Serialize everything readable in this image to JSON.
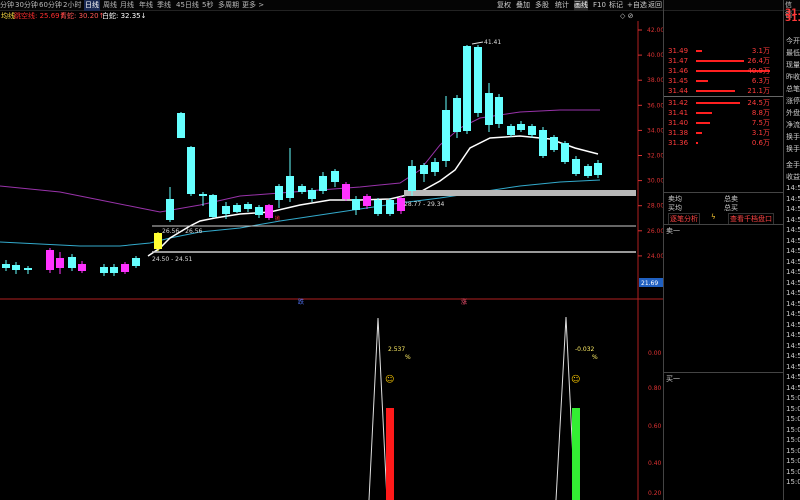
{
  "toolbar": {
    "periods": [
      "分钟",
      "30分钟",
      "60分钟",
      "2小时",
      "日线",
      "周线",
      "月线",
      "年线",
      "季线",
      "45日线",
      "5秒",
      "多周期",
      "更多 >"
    ],
    "active_period": "日线",
    "right_buttons": [
      "复权",
      "叠加",
      "多股",
      "统计",
      "画线",
      "F10",
      "标记",
      "+自选",
      "返回"
    ],
    "panel_title": "信德",
    "small_icons": "◇ ⊘"
  },
  "ma_legend": {
    "name": "均线",
    "items": [
      {
        "label": "跳空线: 25.69↑",
        "color": "#ff2e2e"
      },
      {
        "label": "青蛇: 30.20↑",
        "color": "#ff5555"
      },
      {
        "label": "白蛇: 32.35↓",
        "color": "#ffffff"
      }
    ]
  },
  "price_axis": {
    "labels": [
      "42.00",
      "40.00",
      "38.00",
      "36.00",
      "34.00",
      "32.00",
      "30.00",
      "28.00",
      "26.00",
      "24.00"
    ],
    "current_price": "21.69",
    "current_price_bg": "#2060c0"
  },
  "annotations": {
    "peak": "41.41",
    "zone1": "28.77 - 29.34",
    "zone2": "26.56 - 26.56",
    "zone3": "24.50 - 24.51",
    "small_tag1": "跌",
    "small_tag2": "涨",
    "red_tag": "抛"
  },
  "indicator": {
    "values": [
      {
        "text": "2.537",
        "unit": "%"
      },
      {
        "text": "-0.032",
        "unit": "%"
      }
    ],
    "axis": [
      "0.00",
      "0.80",
      "0.60",
      "0.40",
      "0.20"
    ],
    "smiley": "☺"
  },
  "orderbook": {
    "price_head": "31.",
    "rows": [
      {
        "price": "31.49",
        "vol": "3.1万",
        "bar": 0.08
      },
      {
        "price": "31.47",
        "vol": "26.4万",
        "bar": 0.62
      },
      {
        "price": "31.46",
        "vol": "40.9万",
        "bar": 0.95
      },
      {
        "price": "31.45",
        "vol": "6.3万",
        "bar": 0.15
      },
      {
        "price": "31.44",
        "vol": "21.1万",
        "bar": 0.5
      },
      {
        "price": "31.42",
        "vol": "24.5万",
        "bar": 0.56
      },
      {
        "price": "31.41",
        "vol": "8.8万",
        "bar": 0.2
      },
      {
        "price": "31.40",
        "vol": "7.5万",
        "bar": 0.18
      },
      {
        "price": "31.38",
        "vol": "3.1万",
        "bar": 0.08
      },
      {
        "price": "31.36",
        "vol": "0.6万",
        "bar": 0.02
      }
    ],
    "labels": [
      "今开",
      "最低",
      "现量",
      "昨收",
      "总笔",
      "涨停",
      "外盘",
      "净流",
      "换手",
      "换手"
    ],
    "bottom_labels": [
      "金手",
      "收益"
    ],
    "sell_avg": "卖均",
    "buy_avg": "买均",
    "total_sell": "总卖",
    "total_buy": "总买",
    "analysis_btn": "逐笔分析",
    "tx_btn": "查看千档盘口",
    "sell1": "卖一",
    "buy1": "买一"
  },
  "times": [
    "14:5",
    "14:5",
    "14:5",
    "14:5",
    "14:5",
    "14:5",
    "14:5",
    "14:5",
    "14:5",
    "14:5",
    "14:5",
    "14:5",
    "14:5",
    "14:5",
    "14:5",
    "14:5",
    "14:5",
    "14:5",
    "14:5",
    "14:5",
    "15:0",
    "15:0",
    "15:0",
    "15:0",
    "15:0",
    "15:0",
    "15:0",
    "15:0",
    "15:0"
  ],
  "colors": {
    "up": "#66ffff",
    "down": "#ff33ff",
    "ma_white": "#ffffff",
    "ma_purple": "#9933aa",
    "ma_blue": "#33aacc"
  }
}
